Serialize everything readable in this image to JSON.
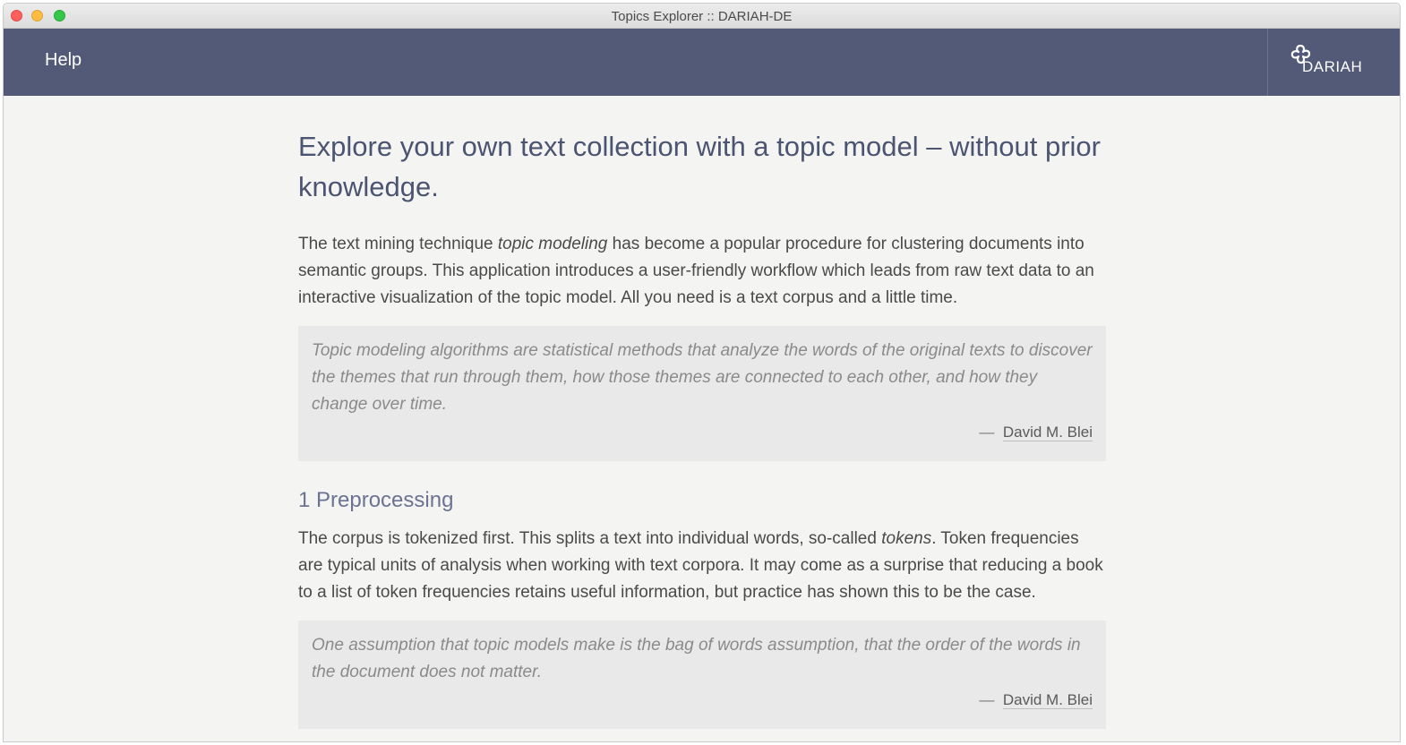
{
  "window": {
    "title": "Topics Explorer :: DARIAH-DE"
  },
  "navbar": {
    "help_label": "Help",
    "logo_text": "DARIAH",
    "color": "#525a78"
  },
  "main": {
    "title": "Explore your own text collection with a topic model – without prior knowledge.",
    "intro": {
      "part1": "The text mining technique ",
      "emphasis": "topic modeling",
      "part2": " has become a popular procedure for clustering documents into semantic groups. This application introduces a user-friendly workflow which leads from raw text data to an interactive visualization of the topic model. All you need is a text corpus and a little time."
    },
    "quote1": {
      "text": "Topic modeling algorithms are statistical methods that analyze the words of the original texts to discover the themes that run through them, how those themes are connected to each other, and how they change over time.",
      "dash": "—",
      "author": "David M. Blei"
    },
    "section1": {
      "heading": "1 Preprocessing",
      "part1": "The corpus is tokenized first. This splits a text into individual words, so-called ",
      "emphasis": "tokens",
      "part2": ". Token frequencies are typical units of analysis when working with text corpora. It may come as a surprise that reducing a book to a list of token frequencies retains useful information, but practice has shown this to be the case."
    },
    "quote2": {
      "text": "One assumption that topic models make is the bag of words assumption, that the order of the words in the document does not matter.",
      "dash": "—",
      "author": "David M. Blei"
    }
  }
}
